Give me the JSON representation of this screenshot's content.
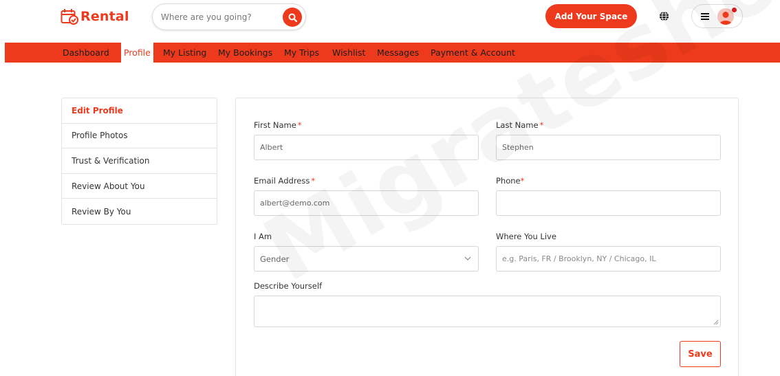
{
  "brand": {
    "name": "Rental",
    "accent": "#ee3a1c"
  },
  "search": {
    "placeholder": "Where are you going?",
    "icon": "search-icon"
  },
  "header": {
    "add_space_label": "Add Your Space",
    "globe_icon": "globe-icon",
    "menu_icon": "hamburger-icon",
    "avatar_icon": "user-avatar-icon"
  },
  "nav": {
    "items": [
      {
        "label": "Dashboard",
        "active": false
      },
      {
        "label": "Profile",
        "active": true
      },
      {
        "label": "My Listing",
        "active": false
      },
      {
        "label": "My Bookings",
        "active": false
      },
      {
        "label": "My Trips",
        "active": false
      },
      {
        "label": "Wishlist",
        "active": false
      },
      {
        "label": "Messages",
        "active": false
      },
      {
        "label": "Payment & Account",
        "active": false
      }
    ]
  },
  "sidebar": {
    "items": [
      {
        "label": "Edit Profile",
        "active": true
      },
      {
        "label": "Profile Photos",
        "active": false
      },
      {
        "label": "Trust & Verification",
        "active": false
      },
      {
        "label": "Review About You",
        "active": false
      },
      {
        "label": "Review By You",
        "active": false
      }
    ]
  },
  "form": {
    "first_name": {
      "label": "First Name",
      "required": "*",
      "value": "Albert"
    },
    "last_name": {
      "label": "Last Name",
      "required": "*",
      "value": "Stephen"
    },
    "email": {
      "label": "Email Address",
      "required": "*",
      "value": "albert@demo.com"
    },
    "phone": {
      "label": "Phone",
      "required": "*",
      "value": ""
    },
    "i_am": {
      "label": "I Am",
      "selected": "Gender"
    },
    "where_live": {
      "label": "Where You Live",
      "placeholder": "e.g. Paris, FR / Brooklyn, NY / Chicago, IL"
    },
    "describe": {
      "label": "Describe Yourself",
      "value": ""
    },
    "save_label": "Save"
  },
  "watermark": "Migrateshop"
}
